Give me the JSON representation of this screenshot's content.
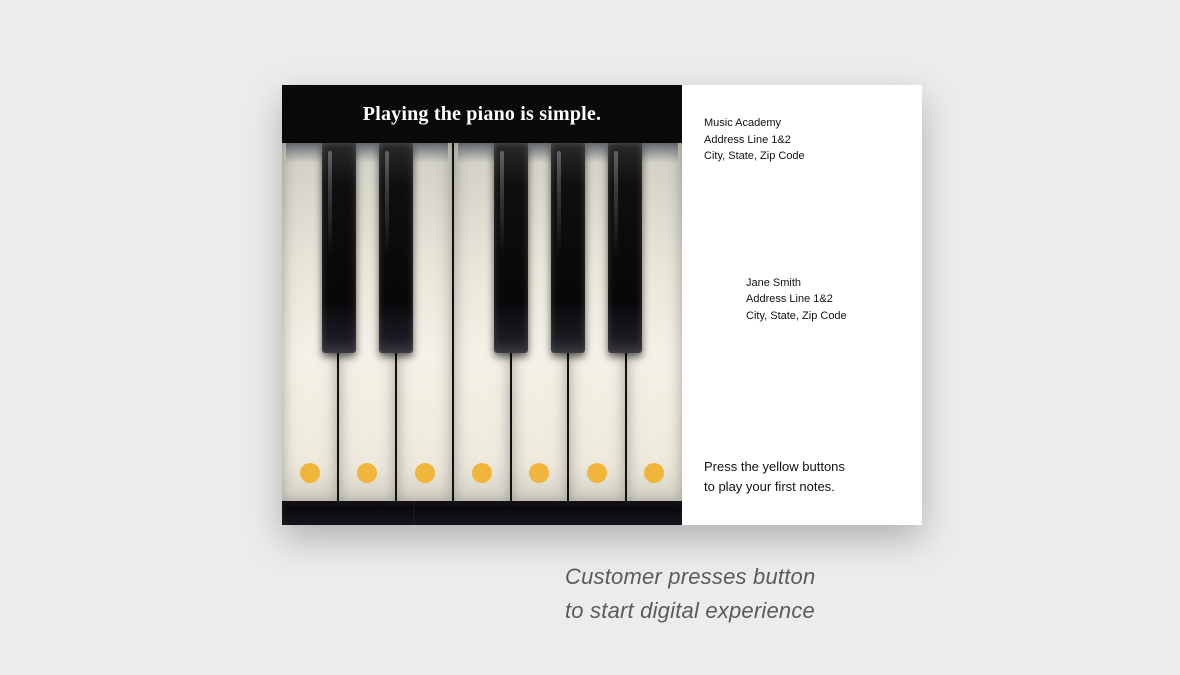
{
  "headline": "Playing the piano is simple.",
  "sender": {
    "name": "Music Academy",
    "addr1": "Address Line 1&2",
    "addr2": "City, State, Zip Code"
  },
  "recipient": {
    "name": "Jane Smith",
    "addr1": "Address Line 1&2",
    "addr2": "City, State, Zip Code"
  },
  "instruction_line1": "Press the yellow buttons",
  "instruction_line2": "to play your first notes.",
  "caption_line1": "Customer presses button",
  "caption_line2": "to start digital experience",
  "colors": {
    "dot": "#f0b53b"
  }
}
